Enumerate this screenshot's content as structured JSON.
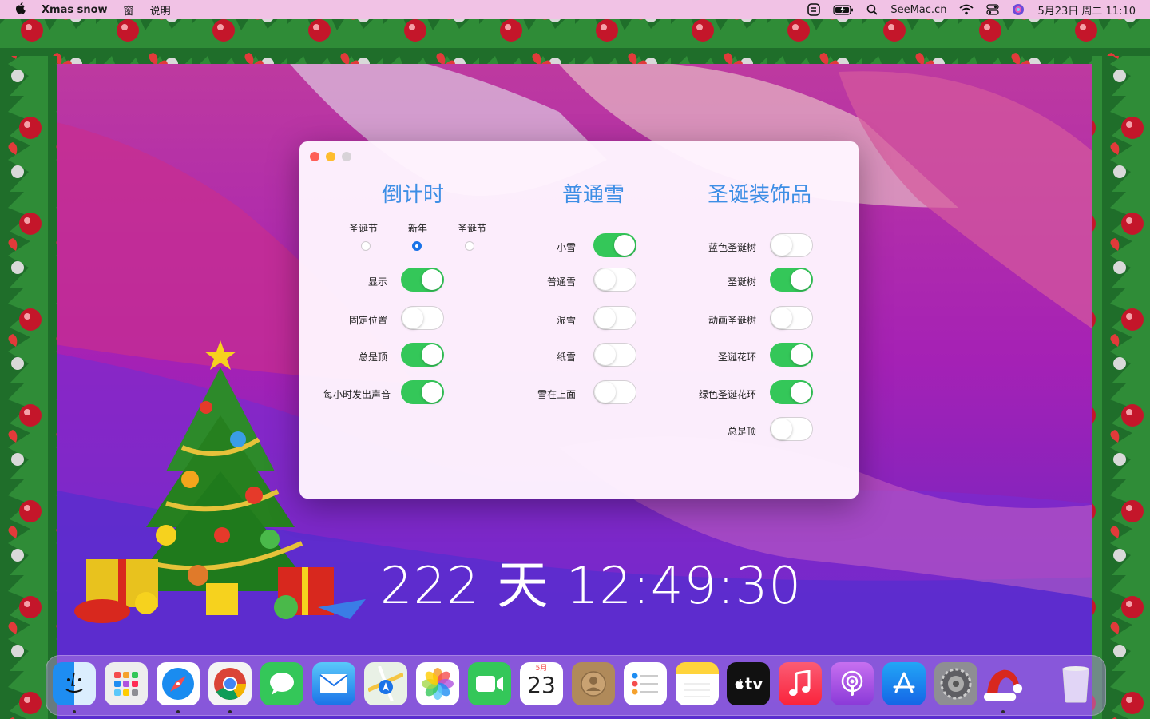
{
  "menubar": {
    "app_name": "Xmas snow",
    "menu_window": "窗",
    "menu_help": "说明",
    "site": "SeeMac.cn",
    "datetime": "5月23日 周二  11:10"
  },
  "window": {
    "columns": [
      {
        "title": "倒计时"
      },
      {
        "title": "普通雪"
      },
      {
        "title": "圣诞装饰品"
      }
    ],
    "countdown_modes": [
      {
        "label": "圣诞节",
        "checked": false
      },
      {
        "label": "新年",
        "checked": true
      },
      {
        "label": "圣诞节",
        "checked": false
      }
    ],
    "col1_toggles": [
      {
        "label": "显示",
        "on": true
      },
      {
        "label": "固定位置",
        "on": false
      },
      {
        "label": "总是顶",
        "on": true
      },
      {
        "label": "每小时发出声音",
        "on": true
      }
    ],
    "col2_toggles": [
      {
        "label": "小雪",
        "on": true
      },
      {
        "label": "普通雪",
        "on": false
      },
      {
        "label": "湿雪",
        "on": false
      },
      {
        "label": "纸雪",
        "on": false
      },
      {
        "label": "雪在上面",
        "on": false
      }
    ],
    "col3_toggles": [
      {
        "label": "蓝色圣诞树",
        "on": false
      },
      {
        "label": "圣诞树",
        "on": true
      },
      {
        "label": "动画圣诞树",
        "on": false
      },
      {
        "label": "圣诞花环",
        "on": true
      },
      {
        "label": "绿色圣诞花环",
        "on": true
      },
      {
        "label": "总是顶",
        "on": false
      }
    ]
  },
  "countdown": {
    "text": "222 天 12:49:30"
  },
  "dock": {
    "calendar_month": "5月",
    "calendar_day": "23",
    "tv_label": "tv"
  },
  "colors": {
    "accent": "#3d8ee5",
    "toggle_on": "#34c759",
    "radio_checked": "#1a73e8"
  }
}
